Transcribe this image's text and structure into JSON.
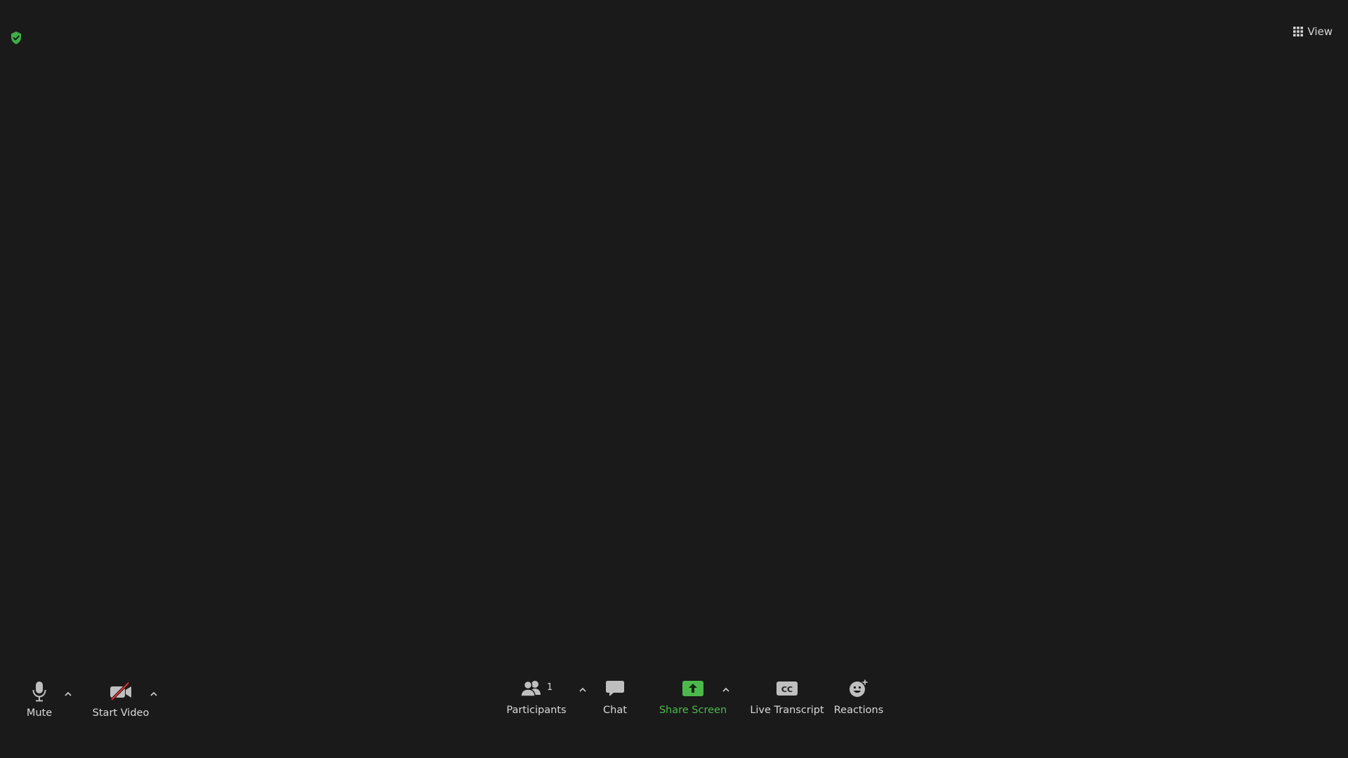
{
  "header": {
    "view_label": "View",
    "shield_icon": "shield-check-icon",
    "view_icon": "grid-icon"
  },
  "toolbar": {
    "mute": {
      "label": "Mute",
      "icon": "microphone-icon"
    },
    "video": {
      "label": "Start Video",
      "icon": "video-off-icon"
    },
    "participants": {
      "label": "Participants",
      "count": "1",
      "icon": "participants-icon"
    },
    "chat": {
      "label": "Chat",
      "icon": "chat-icon"
    },
    "share": {
      "label": "Share Screen",
      "icon": "share-screen-icon"
    },
    "transcript": {
      "label": "Live Transcript",
      "icon": "cc-icon",
      "icon_text": "CC"
    },
    "reactions": {
      "label": "Reactions",
      "icon": "reactions-icon"
    }
  },
  "colors": {
    "background": "#1a1a1a",
    "accent_green": "#4cb94c",
    "text": "#d9d9d9",
    "icon_gray": "#bfbfbf",
    "video_off_red": "#e0312e"
  }
}
